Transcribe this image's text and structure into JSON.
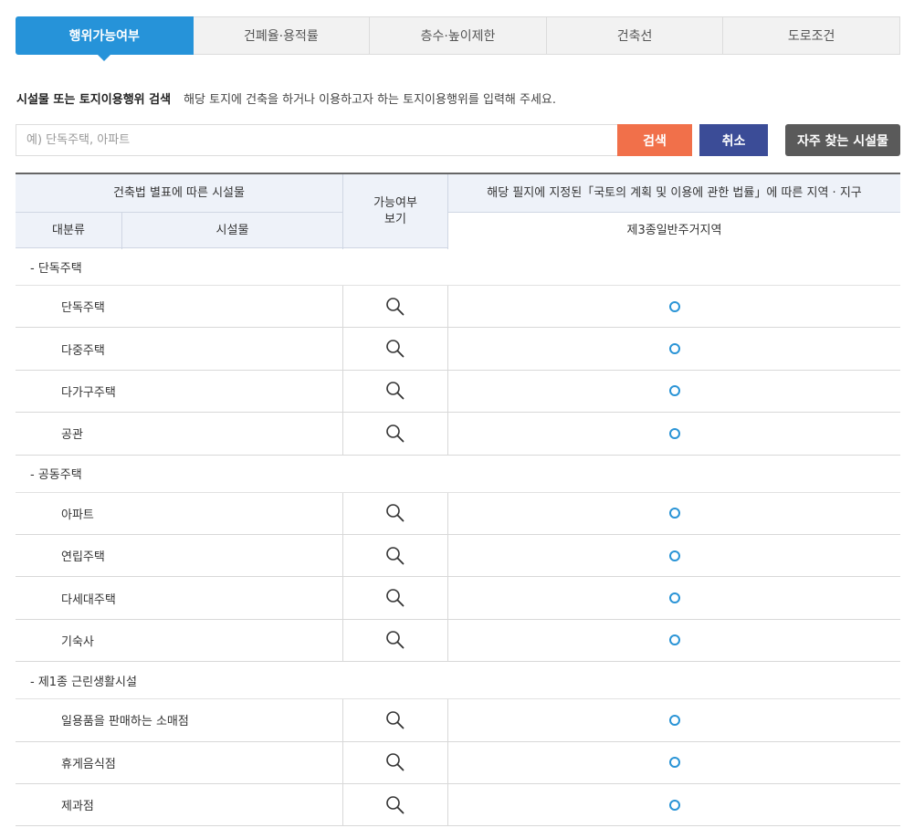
{
  "tabs": [
    {
      "label": "행위가능여부",
      "active": true
    },
    {
      "label": "건폐율·용적률",
      "active": false
    },
    {
      "label": "층수·높이제한",
      "active": false
    },
    {
      "label": "건축선",
      "active": false
    },
    {
      "label": "도로조건",
      "active": false
    }
  ],
  "search": {
    "label": "시설물 또는 토지이용행위 검색",
    "hint": "해당 토지에 건축을 하거나 이용하고자 하는 토지이용행위를 입력해 주세요.",
    "placeholder": "예) 단독주택, 아파트",
    "value": "",
    "search_button": "검색",
    "cancel_button": "취소",
    "frequent_button": "자주 찾는 시설물"
  },
  "table": {
    "header_building": "건축법 별표에 따른 시설물",
    "header_major": "대분류",
    "header_facility": "시설물",
    "header_possible": "가능여부\n보기",
    "header_zone_top": "해당 필지에 지정된「국토의 계획 및 이용에 관한 법률」에 따른 지역 · 지구",
    "header_zone": "제3종일반주거지역",
    "groups": [
      {
        "name": "- 단독주택",
        "items": [
          {
            "name": "단독주택",
            "result": "circle"
          },
          {
            "name": "다중주택",
            "result": "circle"
          },
          {
            "name": "다가구주택",
            "result": "circle"
          },
          {
            "name": "공관",
            "result": "circle"
          }
        ]
      },
      {
        "name": "- 공동주택",
        "items": [
          {
            "name": "아파트",
            "result": "circle"
          },
          {
            "name": "연립주택",
            "result": "circle"
          },
          {
            "name": "다세대주택",
            "result": "circle"
          },
          {
            "name": "기숙사",
            "result": "circle"
          }
        ]
      },
      {
        "name": "- 제1종 근린생활시설",
        "items": [
          {
            "name": "일용품을 판매하는 소매점",
            "result": "circle"
          },
          {
            "name": "휴게음식점",
            "result": "circle"
          },
          {
            "name": "제과점",
            "result": "circle"
          }
        ]
      }
    ]
  },
  "colors": {
    "accent": "#2693d9",
    "search_button": "#f1704a",
    "cancel_button": "#3b4c97",
    "frequent_button": "#5a5a5a",
    "possible_mark": "#2a94d6"
  },
  "icons": {
    "view": "magnifier-icon",
    "possible": "circle-mark-icon"
  }
}
